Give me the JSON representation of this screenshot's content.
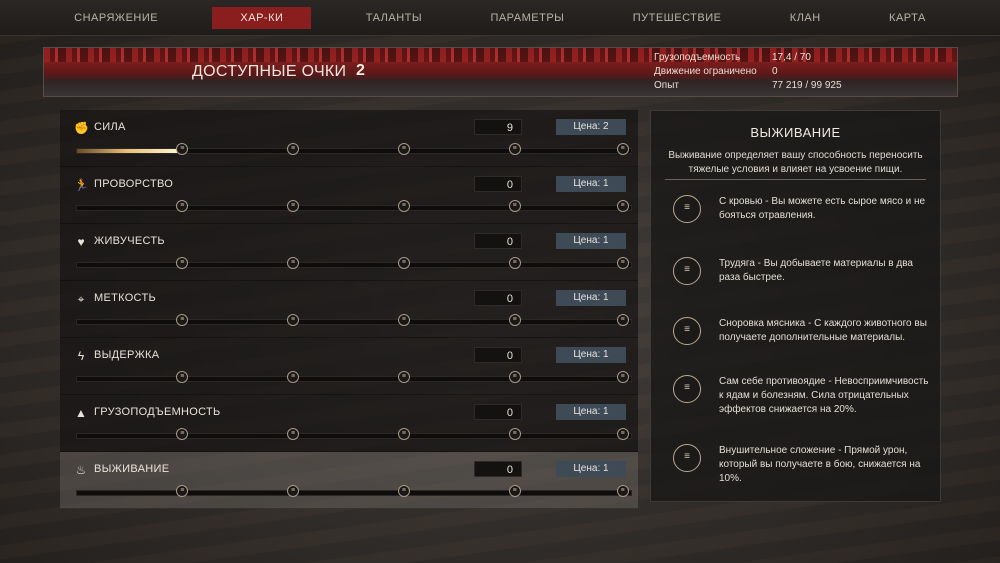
{
  "nav": {
    "tabs": [
      {
        "label": "СНАРЯЖЕНИЕ",
        "active": false
      },
      {
        "label": "ХАР-КИ",
        "active": true
      },
      {
        "label": "ТАЛАНТЫ",
        "active": false
      },
      {
        "label": "ПАРАМЕТРЫ",
        "active": false
      },
      {
        "label": "ПУТЕШЕСТВИЕ",
        "active": false
      },
      {
        "label": "КЛАН",
        "active": false
      },
      {
        "label": "КАРТА",
        "active": false
      }
    ]
  },
  "header": {
    "points_label": "ДОСТУПНЫЕ ОЧКИ",
    "points_value": "2",
    "stats": [
      {
        "label": "Грузоподъемность",
        "value": "17,4 / 70"
      },
      {
        "label": "Движение ограничено",
        "value": "0"
      },
      {
        "label": "Опыт",
        "value": "77 219 / 99 925"
      }
    ]
  },
  "attributes": [
    {
      "name": "СИЛА",
      "icon": "fist-icon",
      "value": "9",
      "cost": "Цена: 2",
      "progress": 0.18,
      "selected": false
    },
    {
      "name": "ПРОВОРСТВО",
      "icon": "running-figure-icon",
      "value": "0",
      "cost": "Цена: 1",
      "progress": 0,
      "selected": false
    },
    {
      "name": "ЖИВУЧЕСТЬ",
      "icon": "heart-icon",
      "value": "0",
      "cost": "Цена: 1",
      "progress": 0,
      "selected": false
    },
    {
      "name": "МЕТКОСТЬ",
      "icon": "crosshair-icon",
      "value": "0",
      "cost": "Цена: 1",
      "progress": 0,
      "selected": false
    },
    {
      "name": "ВЫДЕРЖКА",
      "icon": "lightning-icon",
      "value": "0",
      "cost": "Цена: 1",
      "progress": 0,
      "selected": false
    },
    {
      "name": "ГРУЗОПОДЪЕМНОСТЬ",
      "icon": "weight-icon",
      "value": "0",
      "cost": "Цена: 1",
      "progress": 0,
      "selected": false
    },
    {
      "name": "ВЫЖИВАНИЕ",
      "icon": "campfire-icon",
      "value": "0",
      "cost": "Цена: 1",
      "progress": 0,
      "selected": true
    }
  ],
  "detail": {
    "title": "ВЫЖИВАНИЕ",
    "description": "Выживание определяет вашу способность переносить тяжелые условия и влияет на усвоение пищи.",
    "perks": [
      {
        "icon": "perk-rank-1-icon",
        "text": "С кровью - Вы можете есть сырое мясо и не бояться отравления."
      },
      {
        "icon": "perk-rank-2-icon",
        "text": "Трудяга - Вы добываете материалы в два раза быстрее."
      },
      {
        "icon": "perk-rank-3-icon",
        "text": "Сноровка мясника - С каждого животного вы получаете дополнительные материалы."
      },
      {
        "icon": "perk-rank-4-icon",
        "text": "Сам себе противоядие - Невосприимчивость к ядам и болезням. Сила отрицательных эффектов снижается на 20%."
      },
      {
        "icon": "perk-rank-5-icon",
        "text": "Внушительное сложение - Прямой урон, который вы получаете в бою, снижается на 10%."
      }
    ]
  }
}
